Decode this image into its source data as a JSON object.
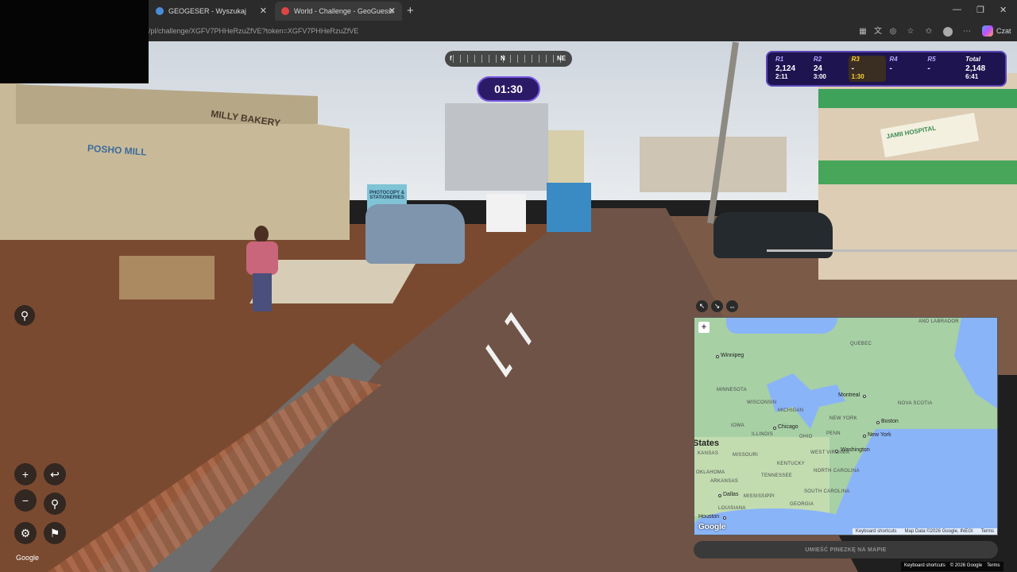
{
  "browser": {
    "tabs": [
      {
        "title": "GEOGESER - Wyszukaj"
      },
      {
        "title": "World - Challenge - GeoGuessr"
      }
    ],
    "url": "/pl/challenge/XGFV7PHHeRzuZfVE?token=XGFV7PHHeRzuZfVE",
    "copilot_label": "Czat",
    "new_tab_glyph": "+",
    "close_glyph": "✕",
    "win_minimize": "—",
    "win_restore": "❐",
    "win_close": "✕"
  },
  "compass": {
    "left": "f",
    "center": "N",
    "right": "NE"
  },
  "timer": "01:30",
  "scoreboard": {
    "rounds": [
      {
        "label": "R1",
        "points": "2,124",
        "time": "2:11"
      },
      {
        "label": "R2",
        "points": "24",
        "time": "3:00"
      },
      {
        "label": "R3",
        "points": "-",
        "time": "1:30"
      },
      {
        "label": "R4",
        "points": "-",
        "time": ""
      },
      {
        "label": "R5",
        "points": "-",
        "time": ""
      }
    ],
    "total": {
      "label": "Total",
      "points": "2,148",
      "time": "6:41"
    },
    "current_round_index": 2
  },
  "scene_signs": {
    "milly": "MILLY BAKERY",
    "posho": "POSHO MILL",
    "hospital": "JAMII HOSPITAL",
    "photocopy": "PHOTOCOPY & STATIONERIES"
  },
  "controls": {
    "zoom_in": "+",
    "zoom_out": "−",
    "undo": "↩",
    "checkpoint": "⚲",
    "settings": "⚙",
    "flag": "⚑",
    "pin": "⚲"
  },
  "google_label": "Google",
  "map": {
    "tools": [
      "↖",
      "↘",
      "⇔"
    ],
    "zoom": "+",
    "labels": {
      "labrador": "AND LABRADOR",
      "quebec": "QUEBEC",
      "minnesota": "MINNESOTA",
      "wisconsin": "WISCONSIN",
      "michigan": "MICHIGAN",
      "new_york": "NEW YORK",
      "nova_scotia": "NOVA SCOTIA",
      "iowa": "IOWA",
      "illinois": "ILLINOIS",
      "ohio": "OHIO",
      "penn": "PENN",
      "kansas": "KANSAS",
      "missouri": "MISSOURI",
      "kentucky": "KENTUCKY",
      "west_virginia": "WEST VIRGINIA",
      "arkansas": "ARKANSAS",
      "north_carolina": "NORTH CAROLINA",
      "south_carolina": "SOUTH CAROLINA",
      "georgia": "GEORGIA",
      "louisiana": "LOUISIANA",
      "tennessee": "TENNESSEE",
      "mississippi": "MISSISSIPPI",
      "oklahoma": "OKLAHOMA",
      "states": "States"
    },
    "cities": {
      "winnipeg": "Winnipeg",
      "montreal": "Montreal",
      "boston": "Boston",
      "new_york": "New York",
      "chicago": "Chicago",
      "washington": "Washington",
      "dallas": "Dallas",
      "houston": "Houston"
    },
    "google": "Google",
    "attrib": [
      "Keyboard shortcuts",
      "Map Data ©2026 Google, INEGI",
      "Terms"
    ]
  },
  "place_pin_label": "UMIEŚĆ PINEZKĘ NA MAPIE",
  "footer": [
    "Keyboard shortcuts",
    "© 2026 Google",
    "Terms"
  ],
  "colors": {
    "accent": "#5b46b8",
    "score_bg": "#1d1450",
    "current_round": "#ffd23c",
    "ocean": "#8ab4f8"
  }
}
